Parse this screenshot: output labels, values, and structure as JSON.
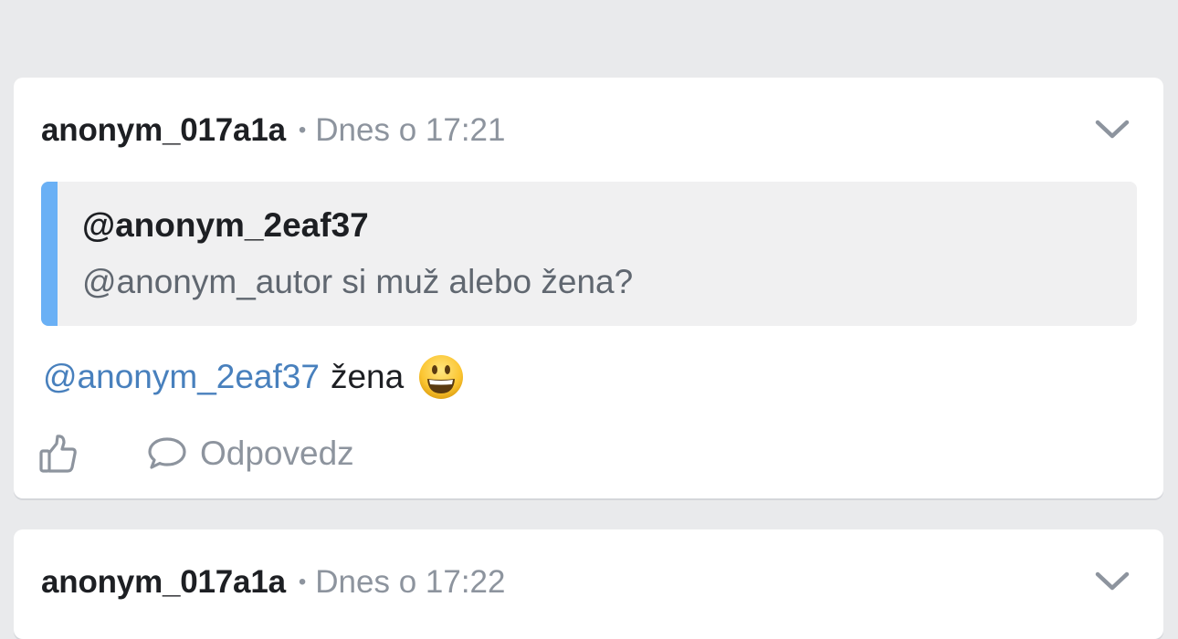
{
  "comments": [
    {
      "author": "anonym_017a1a",
      "separator": "•",
      "time": "Dnes o 17:21",
      "quote": {
        "author": "@anonym_2eaf37",
        "text": "@anonym_autor si muž alebo žena?"
      },
      "body": {
        "mention": "@anonym_2eaf37",
        "text": "žena",
        "emoji": "smiling-face-emoji"
      },
      "actions": {
        "like_icon": "thumbs-up-icon",
        "reply_icon": "speech-bubble-icon",
        "reply_label": "Odpovedz"
      },
      "menu_icon": "chevron-down-icon"
    },
    {
      "author": "anonym_017a1a",
      "separator": "•",
      "time": "Dnes o 17:22",
      "menu_icon": "chevron-down-icon"
    }
  ],
  "colors": {
    "background": "#e9eaec",
    "card": "#ffffff",
    "quote_accent": "#6ab0f5",
    "mention": "#4880bd",
    "muted": "#8d949e"
  }
}
